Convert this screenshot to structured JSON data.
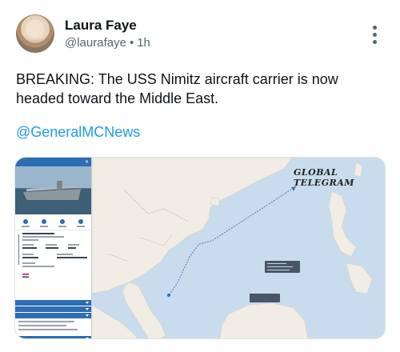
{
  "author": {
    "name": "Laura Faye",
    "handle": "@laurafaye",
    "separator": "•",
    "time": "1h"
  },
  "post": {
    "text": "BREAKING: The USS Nimitz aircraft carrier is now headed toward the Middle East.",
    "mention": "@GeneralMCNews"
  },
  "media": {
    "watermark": "GLOBAL TELEGRAM"
  },
  "icons": {
    "more": "more-options-icon",
    "avatar": "avatar"
  },
  "colors": {
    "link": "#1d9bf0",
    "text": "#0f1419",
    "muted": "#536471",
    "panel_accent": "#2d6db3",
    "sea": "#c9dced",
    "land": "#f1ede4",
    "track": "#4a6cb0"
  }
}
